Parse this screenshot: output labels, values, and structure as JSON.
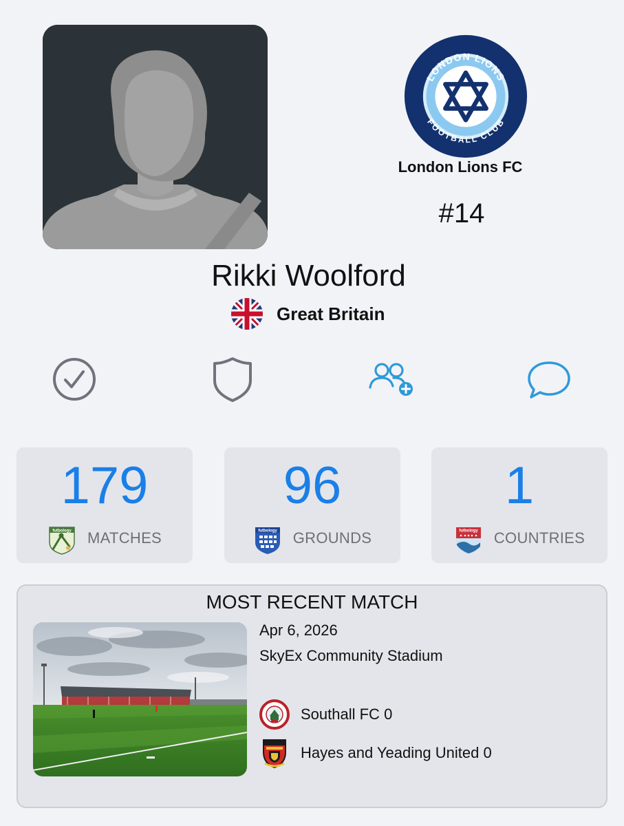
{
  "player": {
    "name": "Rikki Woolford",
    "nationality": "Great Britain",
    "photo_icon": "player-silhouette"
  },
  "club": {
    "name": "London Lions FC",
    "badge_top_text": "LONDON LIONS",
    "badge_bottom_text": "FOOTBALL CLUB",
    "shirt_number": "#14",
    "colors": {
      "navy": "#12316e",
      "light_blue": "#8cc9f0"
    }
  },
  "actions": [
    {
      "icon": "check-circle-icon"
    },
    {
      "icon": "shield-icon"
    },
    {
      "icon": "add-friends-icon"
    },
    {
      "icon": "chat-bubble-icon"
    }
  ],
  "stats": [
    {
      "value": "179",
      "label": "MATCHES",
      "logo": "futbology-matches-logo"
    },
    {
      "value": "96",
      "label": "GROUNDS",
      "logo": "futbology-grounds-logo"
    },
    {
      "value": "1",
      "label": "COUNTRIES",
      "logo": "futbology-countries-logo"
    }
  ],
  "stat_logo_text": "futbology",
  "recent_match": {
    "title": "MOST RECENT MATCH",
    "date": "Apr 6, 2026",
    "venue": "SkyEx Community Stadium",
    "home": {
      "name": "Southall FC",
      "score": "0"
    },
    "away": {
      "name": "Hayes and Yeading United",
      "score": "0"
    }
  },
  "colors": {
    "accent": "#1a7fe8",
    "icon_gray": "#6e737c",
    "icon_blue": "#2f9ad9",
    "background": "#f2f3f7",
    "card": "#e4e5ea"
  }
}
